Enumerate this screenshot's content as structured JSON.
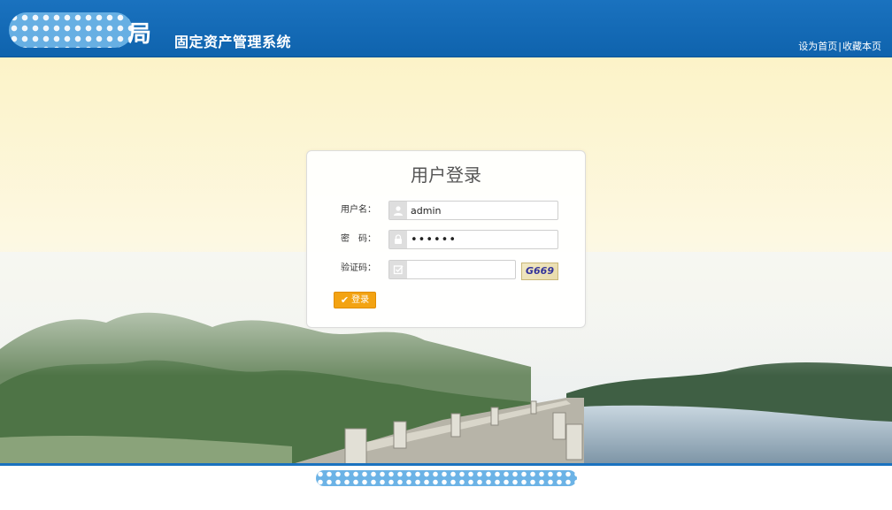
{
  "header": {
    "brand_suffix": "局",
    "system_title": "固定资产管理系统",
    "links": {
      "set_homepage": "设为首页",
      "separator": "|",
      "bookmark": "收藏本页"
    }
  },
  "login": {
    "title": "用户登录",
    "username": {
      "label": "用户名：",
      "value": "admin"
    },
    "password": {
      "label": "密　码：",
      "value": "••••••"
    },
    "captcha": {
      "label": "验证码：",
      "value": "",
      "code": "G669"
    },
    "submit_label": "登录"
  },
  "colors": {
    "header_blue": "#1a72bf",
    "button_orange": "#f3a312"
  },
  "icons": {
    "username": "user-icon",
    "password": "lock-icon",
    "captcha": "checkbox-icon",
    "submit": "check-icon"
  }
}
